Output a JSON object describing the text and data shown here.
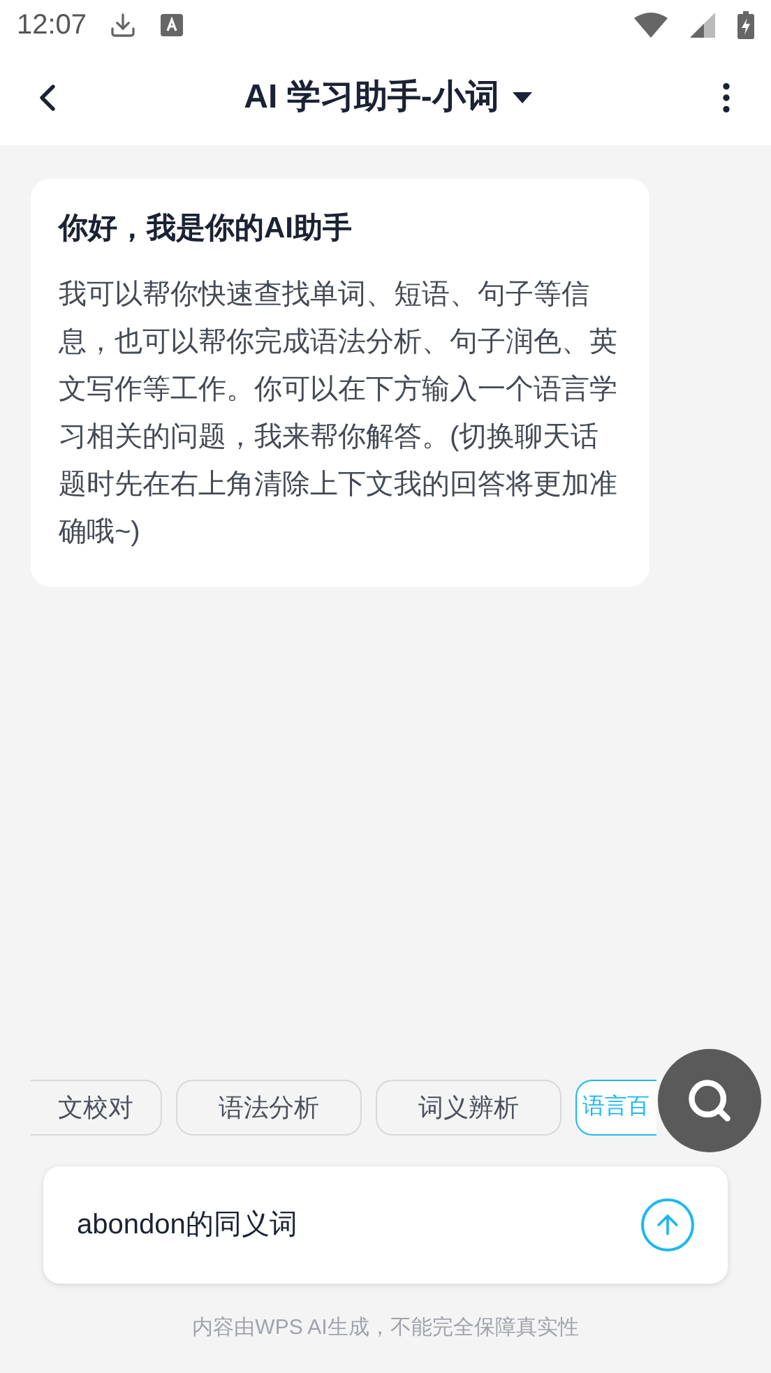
{
  "status_bar": {
    "time": "12:07"
  },
  "header": {
    "title": "AI 学习助手-小词"
  },
  "message": {
    "title": "你好，我是你的AI助手",
    "body": "我可以帮你快速查找单词、短语、句子等信息，也可以帮你完成语法分析、句子润色、英文写作等工作。你可以在下方输入一个语言学习相关的问题，我来帮你解答。(切换聊天话题时先在右上角清除上下文我的回答将更加准确哦~)"
  },
  "chips": [
    {
      "label": "文校对",
      "selected": false
    },
    {
      "label": "语法分析",
      "selected": false
    },
    {
      "label": "词义辨析",
      "selected": false
    },
    {
      "label": "语言百",
      "selected": true
    }
  ],
  "input": {
    "value": "abondon的同义词"
  },
  "disclaimer": "内容由WPS AI生成，不能完全保障真实性"
}
